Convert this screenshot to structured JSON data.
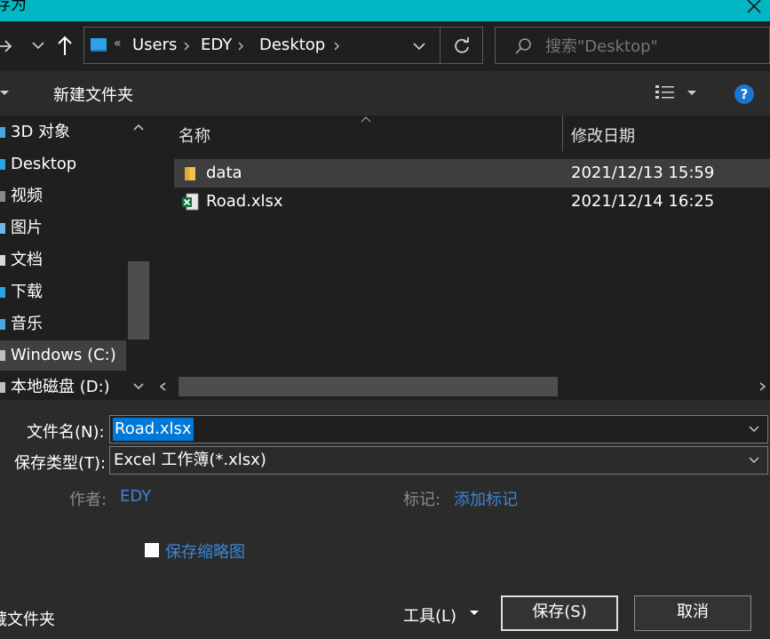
{
  "window": {
    "title": "存为"
  },
  "address": {
    "overflow": "«",
    "crumbs": [
      "Users",
      "EDY",
      "Desktop"
    ]
  },
  "search": {
    "placeholder": "搜索\"Desktop\""
  },
  "toolbar": {
    "new_folder": "新建文件夹"
  },
  "nav_pane": {
    "items": [
      {
        "label": "3D 对象",
        "icon": "3d-objects-icon"
      },
      {
        "label": "Desktop",
        "icon": "desktop-icon"
      },
      {
        "label": "视频",
        "icon": "videos-icon"
      },
      {
        "label": "图片",
        "icon": "pictures-icon"
      },
      {
        "label": "文档",
        "icon": "documents-icon"
      },
      {
        "label": "下载",
        "icon": "downloads-icon"
      },
      {
        "label": "音乐",
        "icon": "music-icon"
      },
      {
        "label": "Windows (C:)",
        "icon": "drive-icon"
      },
      {
        "label": "本地磁盘 (D:)",
        "icon": "drive-icon"
      }
    ]
  },
  "file_list": {
    "columns": [
      "名称",
      "修改日期"
    ],
    "rows": [
      {
        "name": "data",
        "modified": "2021/12/13 15:59",
        "icon": "folder-icon"
      },
      {
        "name": "Road.xlsx",
        "modified": "2021/12/14 16:25",
        "icon": "excel-file-icon"
      }
    ]
  },
  "form": {
    "filename_label": "文件名(N):",
    "filename_value": "Road.xlsx",
    "filetype_label": "保存类型(T):",
    "filetype_value": "Excel 工作簿(*.xlsx)",
    "author_label": "作者:",
    "author_value": "EDY",
    "tags_label": "标记:",
    "tags_value": "添加标记",
    "thumbnail_label": "保存缩略图",
    "hide_folders": "藏文件夹",
    "tools_label": "工具(L)",
    "save_label": "保存(S)",
    "cancel_label": "取消"
  },
  "colors": {
    "titlebar": "#00b7c3",
    "link": "#3a86d6",
    "selection": "#0078d7",
    "excel_green": "#1d6f42",
    "folder_yellow": "#f2c14e",
    "help_blue": "#1976d2"
  }
}
